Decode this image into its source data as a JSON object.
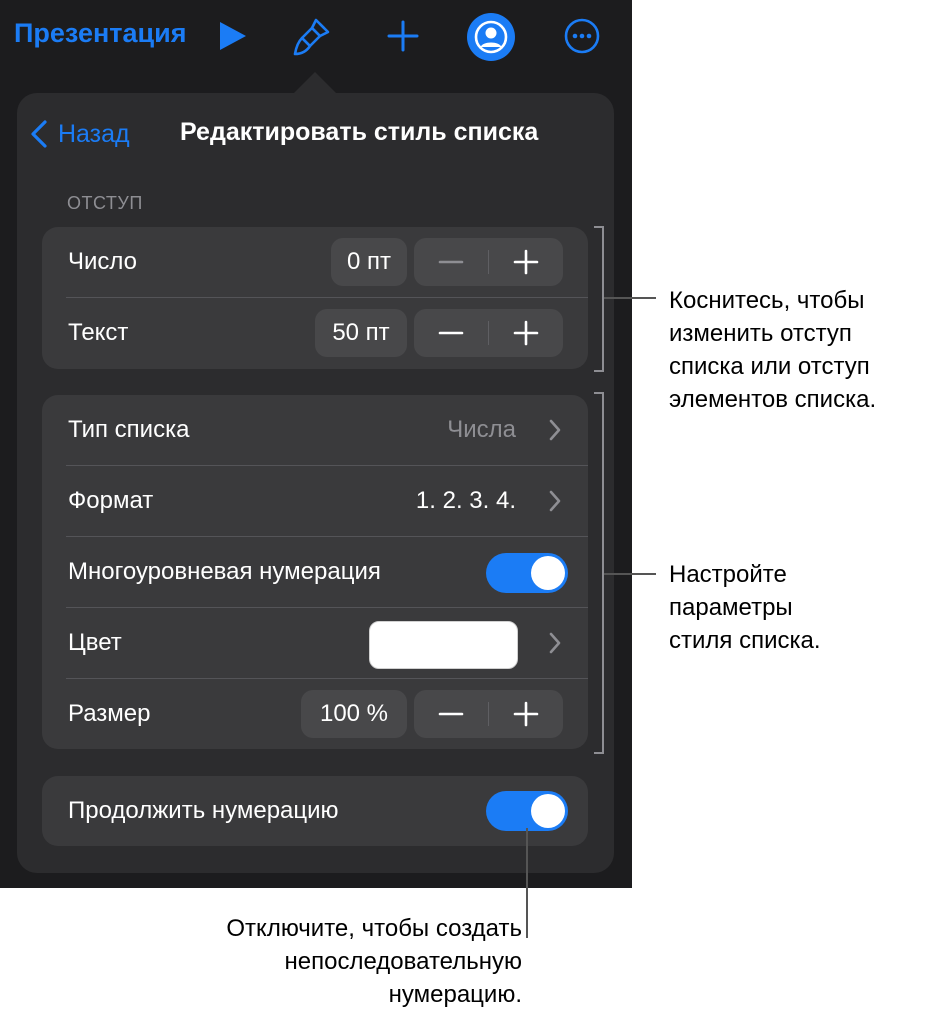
{
  "toolbar": {
    "title": "Презентация",
    "icons": [
      "play-icon",
      "paintbrush-icon",
      "plus-icon",
      "collaborate-icon",
      "more-icon"
    ],
    "accent_color": "#1b7cf5"
  },
  "popover": {
    "back_label": "Назад",
    "title": "Редактировать стиль списка",
    "indent_section": {
      "header": "ОТСТУП",
      "rows": [
        {
          "label": "Число",
          "value": "0 пт"
        },
        {
          "label": "Текст",
          "value": "50 пт"
        }
      ]
    },
    "style_section": {
      "list_type": {
        "label": "Тип списка",
        "value": "Числа"
      },
      "format": {
        "label": "Формат",
        "value": "1. 2. 3. 4."
      },
      "multilevel": {
        "label": "Многоуровневая нумерация",
        "on": true
      },
      "color": {
        "label": "Цвет",
        "value": "#ffffff"
      },
      "size": {
        "label": "Размер",
        "value": "100 %"
      }
    },
    "continue_section": {
      "label": "Продолжить нумерацию",
      "on": true
    }
  },
  "callouts": {
    "indent": [
      "Коснитесь, чтобы",
      "изменить отступ",
      "списка или отступ",
      "элементов списка."
    ],
    "style": [
      "Настройте",
      "параметры",
      "стиля списка."
    ],
    "continue": [
      "Отключите, чтобы создать",
      "непоследовательную",
      "нумерацию."
    ]
  }
}
